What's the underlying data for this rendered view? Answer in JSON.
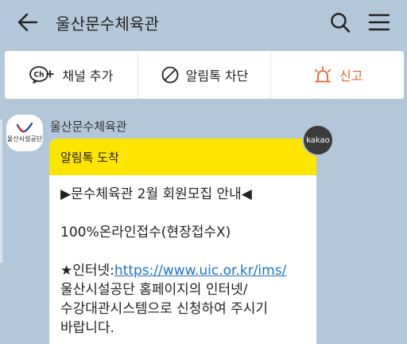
{
  "header": {
    "title": "울산문수체육관"
  },
  "actions": {
    "add_channel": "채널 추가",
    "block_alimtalk": "알림톡 차단",
    "report": "신고"
  },
  "chat": {
    "sender": "울산문수체육관",
    "avatar_text": "울산시설공단",
    "badge": "kakao",
    "bubble_header": "알림톡 도착",
    "line1": "▶문수체육관 2월 회원모집 안내◀",
    "line2": "100%온라인접수(현장접수X)",
    "line3_prefix": "★인터넷:",
    "line3_link": "https://www.uic.or.kr/ims/",
    "line4": "울산시설공단 홈페이지의 인터넷/",
    "line5": "수강대관시스템으로 신청하여 주시기",
    "line6": "바랍니다."
  },
  "colors": {
    "background": "#b2c7da",
    "bubble_header": "#fee500",
    "report": "#e8632b",
    "link": "#1a73c9"
  }
}
